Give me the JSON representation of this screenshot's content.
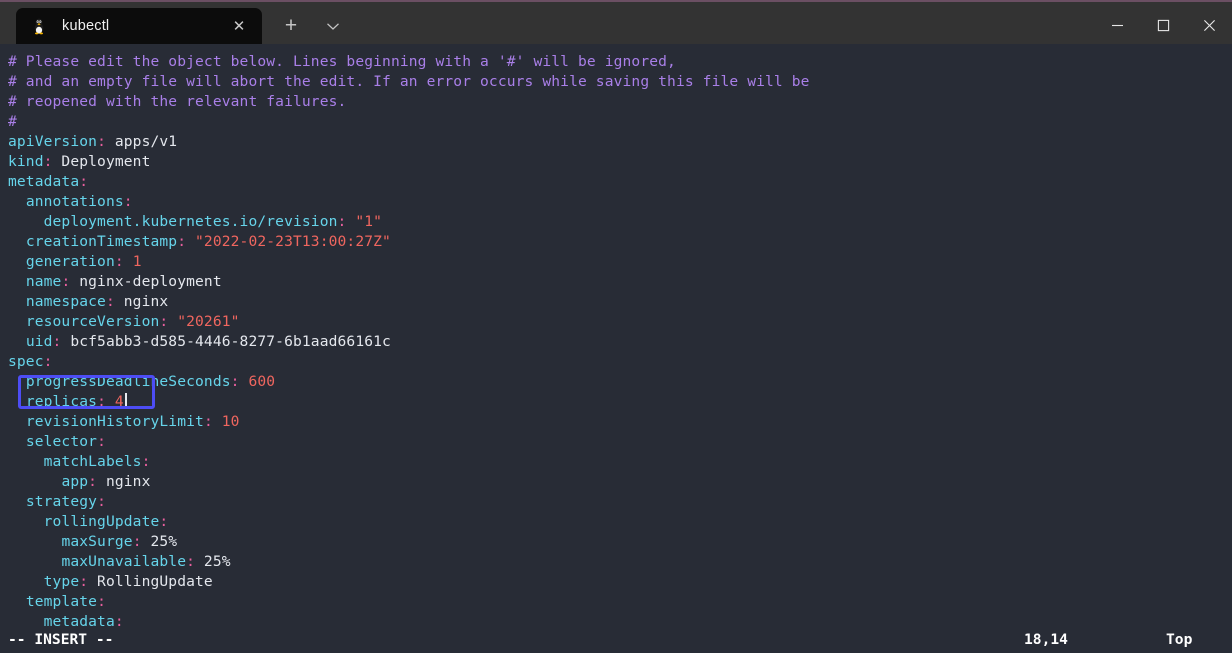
{
  "window": {
    "accent_color": "#6b4f63",
    "titlebar_color": "#333333",
    "terminal_bg": "#282c36",
    "controls": [
      {
        "name": "minimize",
        "glyph": "minimize-icon"
      },
      {
        "name": "maximize",
        "glyph": "maximize-icon"
      },
      {
        "name": "close",
        "glyph": "close-icon"
      }
    ]
  },
  "tabbar": {
    "tabs": [
      {
        "title": "kubectl",
        "icon": "linux-penguin-icon",
        "close_label": "✕",
        "active": true
      }
    ],
    "new_tab_label": "+",
    "dropdown_label": "chevron-down-icon"
  },
  "editor": {
    "name": "vim",
    "lines": [
      {
        "indent": 0,
        "segments": [
          {
            "t": "# Please edit the object below. Lines beginning with a '#' will be ignored,",
            "c": "comment"
          }
        ]
      },
      {
        "indent": 0,
        "segments": [
          {
            "t": "# and an empty file will abort the edit. If an error occurs while saving this file will be",
            "c": "comment"
          }
        ]
      },
      {
        "indent": 0,
        "segments": [
          {
            "t": "# reopened with the relevant failures.",
            "c": "comment"
          }
        ]
      },
      {
        "indent": 0,
        "segments": [
          {
            "t": "#",
            "c": "comment"
          }
        ]
      },
      {
        "indent": 0,
        "segments": [
          {
            "t": "apiVersion",
            "c": "key"
          },
          {
            "t": ":",
            "c": "colon"
          },
          {
            "t": " apps/v1",
            "c": "plain"
          }
        ]
      },
      {
        "indent": 0,
        "segments": [
          {
            "t": "kind",
            "c": "key"
          },
          {
            "t": ":",
            "c": "colon"
          },
          {
            "t": " Deployment",
            "c": "plain"
          }
        ]
      },
      {
        "indent": 0,
        "segments": [
          {
            "t": "metadata",
            "c": "key"
          },
          {
            "t": ":",
            "c": "colon"
          }
        ]
      },
      {
        "indent": 2,
        "segments": [
          {
            "t": "annotations",
            "c": "key"
          },
          {
            "t": ":",
            "c": "colon"
          }
        ]
      },
      {
        "indent": 4,
        "segments": [
          {
            "t": "deployment.kubernetes.io/revision",
            "c": "key"
          },
          {
            "t": ":",
            "c": "colon"
          },
          {
            "t": " ",
            "c": "plain"
          },
          {
            "t": "\"1\"",
            "c": "str"
          }
        ]
      },
      {
        "indent": 2,
        "segments": [
          {
            "t": "creationTimestamp",
            "c": "key"
          },
          {
            "t": ":",
            "c": "colon"
          },
          {
            "t": " ",
            "c": "plain"
          },
          {
            "t": "\"2022-02-23T13:00:27Z\"",
            "c": "str"
          }
        ]
      },
      {
        "indent": 2,
        "segments": [
          {
            "t": "generation",
            "c": "key"
          },
          {
            "t": ":",
            "c": "colon"
          },
          {
            "t": " ",
            "c": "plain"
          },
          {
            "t": "1",
            "c": "num"
          }
        ]
      },
      {
        "indent": 2,
        "segments": [
          {
            "t": "name",
            "c": "key"
          },
          {
            "t": ":",
            "c": "colon"
          },
          {
            "t": " nginx-deployment",
            "c": "plain"
          }
        ]
      },
      {
        "indent": 2,
        "segments": [
          {
            "t": "namespace",
            "c": "key"
          },
          {
            "t": ":",
            "c": "colon"
          },
          {
            "t": " nginx",
            "c": "plain"
          }
        ]
      },
      {
        "indent": 2,
        "segments": [
          {
            "t": "resourceVersion",
            "c": "key"
          },
          {
            "t": ":",
            "c": "colon"
          },
          {
            "t": " ",
            "c": "plain"
          },
          {
            "t": "\"20261\"",
            "c": "str"
          }
        ]
      },
      {
        "indent": 2,
        "segments": [
          {
            "t": "uid",
            "c": "key"
          },
          {
            "t": ":",
            "c": "colon"
          },
          {
            "t": " bcf5abb3-d585-4446-8277-6b1aad66161c",
            "c": "plain"
          }
        ]
      },
      {
        "indent": 0,
        "segments": [
          {
            "t": "spec",
            "c": "key"
          },
          {
            "t": ":",
            "c": "colon"
          }
        ]
      },
      {
        "indent": 2,
        "segments": [
          {
            "t": "progressDeadlineSeconds",
            "c": "key"
          },
          {
            "t": ":",
            "c": "colon"
          },
          {
            "t": " ",
            "c": "plain"
          },
          {
            "t": "600",
            "c": "num"
          }
        ]
      },
      {
        "indent": 2,
        "segments": [
          {
            "t": "replicas",
            "c": "key"
          },
          {
            "t": ":",
            "c": "colon"
          },
          {
            "t": " ",
            "c": "plain"
          },
          {
            "t": "4",
            "c": "num"
          }
        ],
        "caret_after": true
      },
      {
        "indent": 2,
        "segments": [
          {
            "t": "revisionHistoryLimit",
            "c": "key"
          },
          {
            "t": ":",
            "c": "colon"
          },
          {
            "t": " ",
            "c": "plain"
          },
          {
            "t": "10",
            "c": "num"
          }
        ]
      },
      {
        "indent": 2,
        "segments": [
          {
            "t": "selector",
            "c": "key"
          },
          {
            "t": ":",
            "c": "colon"
          }
        ]
      },
      {
        "indent": 4,
        "segments": [
          {
            "t": "matchLabels",
            "c": "key"
          },
          {
            "t": ":",
            "c": "colon"
          }
        ]
      },
      {
        "indent": 6,
        "segments": [
          {
            "t": "app",
            "c": "key"
          },
          {
            "t": ":",
            "c": "colon"
          },
          {
            "t": " nginx",
            "c": "plain"
          }
        ]
      },
      {
        "indent": 2,
        "segments": [
          {
            "t": "strategy",
            "c": "key"
          },
          {
            "t": ":",
            "c": "colon"
          }
        ]
      },
      {
        "indent": 4,
        "segments": [
          {
            "t": "rollingUpdate",
            "c": "key"
          },
          {
            "t": ":",
            "c": "colon"
          }
        ]
      },
      {
        "indent": 6,
        "segments": [
          {
            "t": "maxSurge",
            "c": "key"
          },
          {
            "t": ":",
            "c": "colon"
          },
          {
            "t": " 25%",
            "c": "plain"
          }
        ]
      },
      {
        "indent": 6,
        "segments": [
          {
            "t": "maxUnavailable",
            "c": "key"
          },
          {
            "t": ":",
            "c": "colon"
          },
          {
            "t": " 25%",
            "c": "plain"
          }
        ]
      },
      {
        "indent": 4,
        "segments": [
          {
            "t": "type",
            "c": "key"
          },
          {
            "t": ":",
            "c": "colon"
          },
          {
            "t": " RollingUpdate",
            "c": "plain"
          }
        ]
      },
      {
        "indent": 2,
        "segments": [
          {
            "t": "template",
            "c": "key"
          },
          {
            "t": ":",
            "c": "colon"
          }
        ]
      },
      {
        "indent": 4,
        "segments": [
          {
            "t": "metadata",
            "c": "key"
          },
          {
            "t": ":",
            "c": "colon"
          }
        ]
      }
    ],
    "annotation": {
      "shape": "rectangle",
      "color": "#4d4df5",
      "target_line": "replicas: 4"
    }
  },
  "statusbar": {
    "mode": "-- INSERT --",
    "cursor_position": "18,14",
    "scroll_position": "Top"
  }
}
